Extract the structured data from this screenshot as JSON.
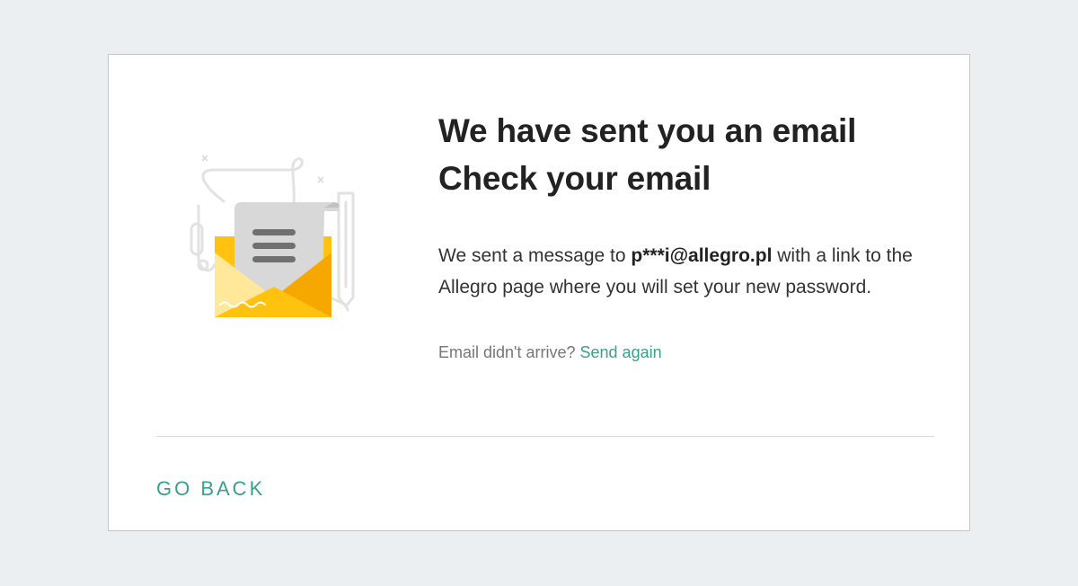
{
  "illustration": {
    "icon": "envelope-with-letter-icon",
    "colors": {
      "envelope": "#ffc20e",
      "envelope_dark": "#f5a000",
      "envelope_light": "#ffe89a",
      "letter": "#d9d9d9",
      "letter_lines": "#757575",
      "outline": "#e0e0e0"
    }
  },
  "heading": {
    "line1": "We have sent you an email",
    "line2": "Check your email"
  },
  "message": {
    "prefix": "We sent a message to ",
    "email": "p***i@allegro.pl",
    "suffix": " with a link to the Allegro page where you will set your new password."
  },
  "resend": {
    "question": "Email didn't arrive?",
    "link": "Send again"
  },
  "footer": {
    "go_back": "GO BACK"
  },
  "colors": {
    "accent": "#3a9f8c",
    "background": "#eceff1",
    "card": "#ffffff"
  }
}
